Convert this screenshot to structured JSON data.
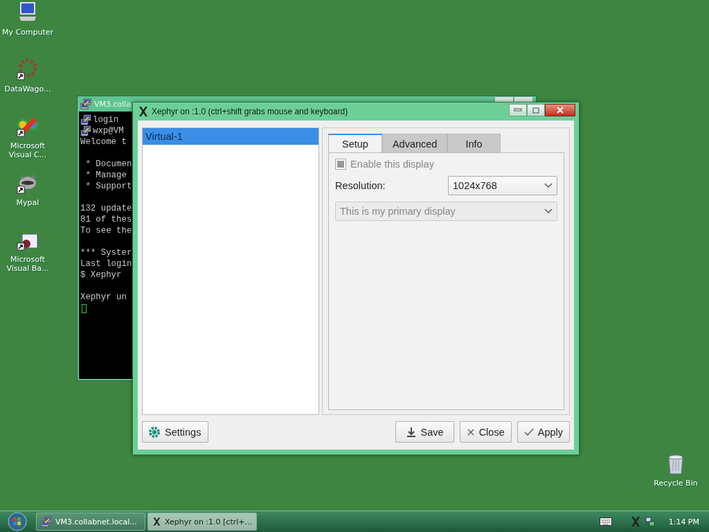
{
  "desktop_icons": [
    {
      "kind": "computer",
      "label": "My Computer",
      "shortcut": false
    },
    {
      "kind": "wheel",
      "label": "DataWago...",
      "shortcut": true
    },
    {
      "kind": "studio",
      "label": "Microsoft Visual C...",
      "shortcut": true
    },
    {
      "kind": "animal",
      "label": "Mypal",
      "shortcut": true
    },
    {
      "kind": "vb",
      "label": "Microsoft Visual Ba...",
      "shortcut": true
    }
  ],
  "recycle_bin": {
    "label": "Recycle Bin"
  },
  "terminal": {
    "title": "VM3.colla",
    "blocks": [
      [
        {
          "text": "login",
          "icon": true
        },
        {
          "text": "wxp@VM",
          "icon": true
        },
        {
          "text": "Welcome t",
          "icon": false
        }
      ],
      [
        {
          "text": " * Documen",
          "icon": false
        },
        {
          "text": " * Manage",
          "icon": false
        },
        {
          "text": " * Support",
          "icon": false
        }
      ],
      [
        {
          "text": "132 update",
          "icon": false
        },
        {
          "text": "81 of thes",
          "icon": false
        },
        {
          "text": "To see the",
          "icon": false
        }
      ],
      [
        {
          "text": "*** Syster",
          "icon": false
        },
        {
          "text": "Last login",
          "icon": false
        },
        {
          "text": "$ Xephyr",
          "icon": false
        }
      ],
      [
        {
          "text": "Xephyr un",
          "icon": false
        }
      ]
    ]
  },
  "dialog": {
    "title": "Xephyr on :1.0 (ctrl+shift grabs mouse and keyboard)",
    "displays": [
      {
        "label": "Virtual-1",
        "selected": true
      }
    ],
    "tabs": [
      {
        "label": "Setup",
        "selected": true
      },
      {
        "label": "Advanced",
        "selected": false
      },
      {
        "label": "Info",
        "selected": false
      }
    ],
    "enable_display": {
      "label": "Enable this display",
      "checked": true,
      "disabled": true
    },
    "resolution": {
      "label": "Resolution:",
      "value": "1024x768"
    },
    "primary": {
      "value": "This is my primary display",
      "disabled": true
    },
    "buttons": [
      {
        "kind": "settings",
        "label": "Settings"
      },
      {
        "kind": "save",
        "label": "Save"
      },
      {
        "kind": "close",
        "label": "Close"
      },
      {
        "kind": "apply",
        "label": "Apply"
      }
    ]
  },
  "taskbar": {
    "tasks": [
      {
        "kind": "putty",
        "label": "VM3.collabnet.local...",
        "selected": false
      },
      {
        "kind": "x",
        "label": "Xephyr on :1.0 [ctrl+...",
        "selected": true
      }
    ],
    "clock": "1:14 PM"
  }
}
